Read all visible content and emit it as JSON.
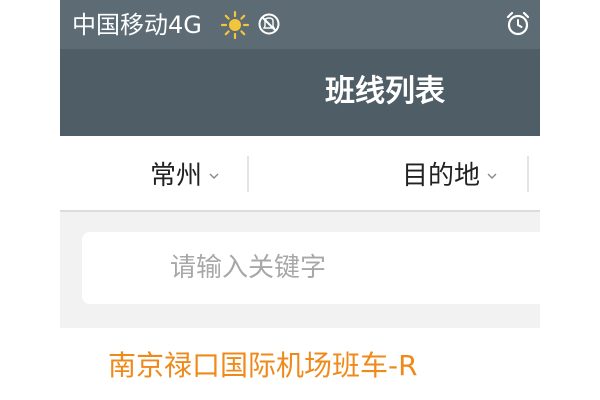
{
  "status_bar": {
    "carrier": "中国移动4G",
    "icons": [
      "sun-icon",
      "do-not-disturb-icon",
      "alarm-icon"
    ]
  },
  "header": {
    "title": "班线列表"
  },
  "filters": {
    "origin_label": "常州",
    "destination_label": "目的地",
    "chevron_icon": "chevron-down-icon"
  },
  "search": {
    "placeholder": "请输入关键字",
    "value": ""
  },
  "routes": [
    {
      "name": "南京禄口国际机场班车-R"
    }
  ],
  "colors": {
    "status_bar": "#5d6b74",
    "header": "#4e5d66",
    "route_accent": "#ef8a1a",
    "search_bg": "#f2f2f2"
  }
}
